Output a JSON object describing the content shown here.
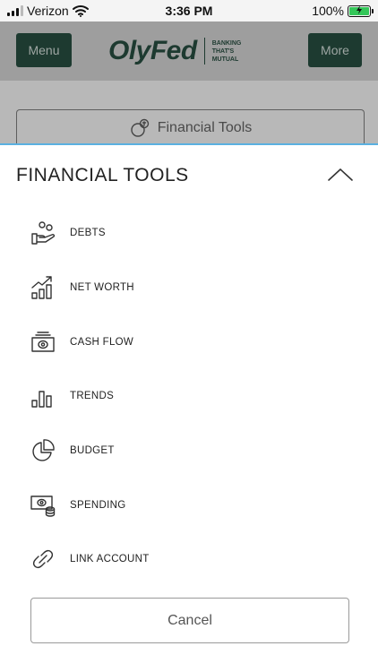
{
  "status_bar": {
    "carrier": "Verizon",
    "time": "3:36 PM",
    "battery": "100%",
    "icons": [
      "signal-icon",
      "wifi-icon",
      "battery-charging-icon"
    ]
  },
  "header": {
    "menu_label": "Menu",
    "more_label": "More",
    "logo_text": "OlyFed",
    "logo_tagline": [
      "BANKING",
      "THAT'S",
      "MUTUAL"
    ]
  },
  "financial_tools_button": {
    "label": "Financial Tools",
    "icon": "coins-icon"
  },
  "sheet": {
    "title": "FINANCIAL TOOLS",
    "collapse_icon": "chevron-up-icon",
    "items": [
      {
        "label": "DEBTS",
        "icon": "hand-coins-icon"
      },
      {
        "label": "NET WORTH",
        "icon": "growth-chart-icon"
      },
      {
        "label": "CASH FLOW",
        "icon": "cash-icon"
      },
      {
        "label": "TRENDS",
        "icon": "bar-chart-icon"
      },
      {
        "label": "BUDGET",
        "icon": "pie-chart-icon"
      },
      {
        "label": "SPENDING",
        "icon": "cash-coins-icon"
      },
      {
        "label": "LINK ACCOUNT",
        "icon": "link-icon"
      }
    ],
    "cancel_label": "Cancel"
  },
  "colors": {
    "brand_dark_green": "#1d3a30",
    "sheet_top_border": "#5ab0e0",
    "overlay_gray": "#b8b8b8"
  }
}
